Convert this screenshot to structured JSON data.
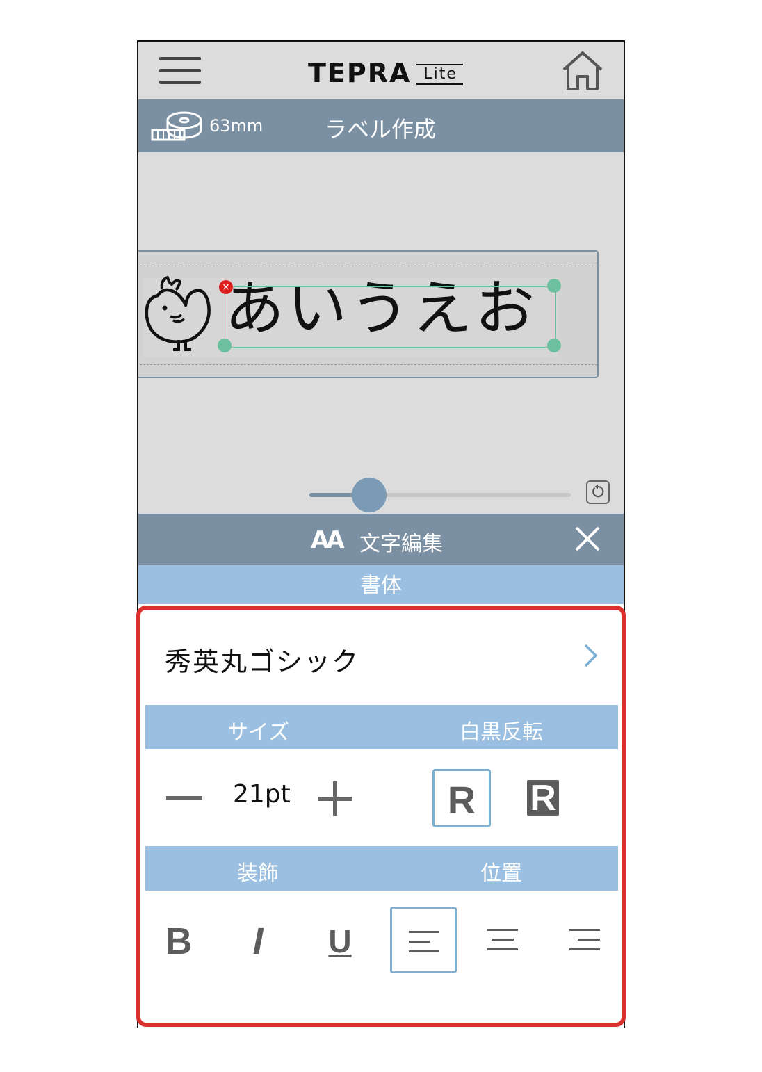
{
  "app": {
    "logo_main": "TEPRA",
    "logo_sub": "Lite"
  },
  "header": {
    "tape_width": "63mm",
    "title": "ラベル作成"
  },
  "label": {
    "text": "あいうえお"
  },
  "zoom": {
    "level": 0.23
  },
  "edit_bar": {
    "icon_text": "AA",
    "title": "文字編集"
  },
  "font_section": {
    "header": "書体",
    "font_name": "秀英丸ゴシック"
  },
  "size_section": {
    "header": "サイズ",
    "value": "21pt"
  },
  "inverse_section": {
    "header": "白黒反転",
    "normal_glyph": "R",
    "inverse_glyph": "R",
    "selected": "normal"
  },
  "decoration_section": {
    "header": "装飾",
    "bold": "B",
    "italic": "I",
    "underline": "U"
  },
  "position_section": {
    "header": "位置",
    "selected": "left"
  },
  "colors": {
    "accent": "#7b90a2",
    "section": "#9bbfe0",
    "highlight": "#d9302c",
    "handle": "#6cc0a0"
  }
}
